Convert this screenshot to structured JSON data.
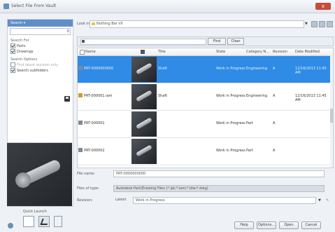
{
  "window": {
    "title": "Select File From Vault",
    "close_label": "x"
  },
  "left_panel": {
    "header": "Search ▾",
    "search_placeholder": "",
    "search_in_label": "Search For",
    "checks": [
      {
        "label": "Parts",
        "checked": true
      },
      {
        "label": "Drawings",
        "checked": true
      }
    ],
    "options_label": "Search Options",
    "options": [
      {
        "label": "Find latest revision only",
        "checked": false,
        "dim": true
      },
      {
        "label": "Search subfolders",
        "checked": true,
        "dim": false
      }
    ]
  },
  "look_in": {
    "label": "Look in:",
    "value": "Nothing Bar Vil"
  },
  "filter": {
    "find_label": "Find",
    "clear_label": "Clear"
  },
  "table": {
    "headers": [
      "Name",
      "Title",
      "State",
      "Category N...",
      "Revision",
      "Date Modified"
    ],
    "rows": [
      {
        "name": "PRT-0000000000",
        "title": "Shaft",
        "state": "Work in Progress",
        "category": "Engineering",
        "revision": "A",
        "date": "12/16/2013 11:45 AM",
        "type": "part",
        "selected": true
      },
      {
        "name": "PRT-000001.iam",
        "title": "Shaft",
        "state": "Work in Progress",
        "category": "Engineering",
        "revision": "A",
        "date": "12/16/2013 11:45 AM",
        "type": "assembly",
        "selected": false
      },
      {
        "name": "PRT-000001",
        "title": "",
        "state": "Work in Progress",
        "category": "Part",
        "revision": "A",
        "date": "",
        "type": "part",
        "selected": false
      },
      {
        "name": "PRT-000002",
        "title": "",
        "state": "Work in Progress",
        "category": "Part",
        "revision": "A",
        "date": "",
        "type": "part",
        "selected": false
      }
    ]
  },
  "fields": {
    "file_name_label": "File name:",
    "file_name_value": "PRT-0000000000",
    "file_type_label": "Files of type:",
    "file_type_value": "Autodesk Part/Drawing Files (*.ipt;*.iam;*.idw;*.dwg)",
    "revision_label": "Revision:",
    "revision_mode": "Latest",
    "revision_value": "Work in Progress"
  },
  "quick_launch": {
    "label": "Quick Launch"
  },
  "buttons": {
    "help": "Help",
    "options": "Options...",
    "open": "Open",
    "cancel": "Cancel"
  }
}
